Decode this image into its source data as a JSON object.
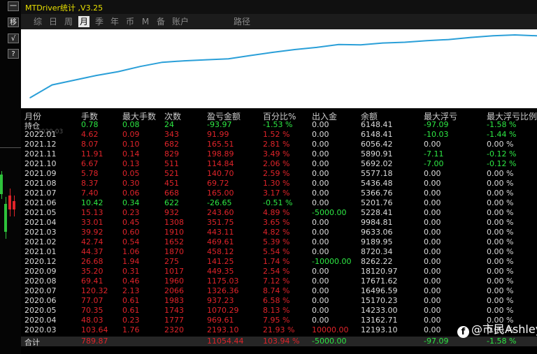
{
  "toolbar": {
    "buttons": [
      {
        "label": "一",
        "name": "minimize-button"
      },
      {
        "label": "移",
        "name": "move-button"
      },
      {
        "label": "√",
        "name": "check-button"
      },
      {
        "label": "?",
        "name": "help-button"
      }
    ]
  },
  "window": {
    "title": "MTDriver统计 ,V3.25"
  },
  "tabs": [
    {
      "label": "综",
      "active": false
    },
    {
      "label": "日",
      "active": false
    },
    {
      "label": "周",
      "active": false
    },
    {
      "label": "月",
      "active": true
    },
    {
      "label": "季",
      "active": false
    },
    {
      "label": "年",
      "active": false
    },
    {
      "label": "币",
      "active": false
    },
    {
      "label": "M",
      "active": false
    },
    {
      "label": "备",
      "active": false
    },
    {
      "label": "账户",
      "active": false
    },
    {
      "label": "路径",
      "active": false
    }
  ],
  "chart_data": {
    "type": "line",
    "x_start_label": "2020.03",
    "x": [
      "2020.03",
      "2020.04",
      "2020.05",
      "2020.06",
      "2020.07",
      "2020.08",
      "2020.09",
      "2020.10",
      "2020.11",
      "2020.12",
      "2021.01",
      "2021.02",
      "2021.03",
      "2021.04",
      "2021.05",
      "2021.06",
      "2021.07",
      "2021.08",
      "2021.09",
      "2021.10",
      "2021.11",
      "2021.12",
      "2022.01",
      "持仓"
    ],
    "values": [
      0.0,
      21.93,
      29.88,
      38.01,
      44.59,
      53.33,
      60.45,
      63.0,
      64.74,
      66.48,
      72.02,
      77.41,
      82.23,
      85.88,
      90.77,
      90.26,
      93.43,
      94.73,
      97.32,
      99.38,
      102.87,
      105.68,
      107.2,
      105.67
    ],
    "line_color": "#2a9fd8",
    "grid": false
  },
  "table": {
    "headers": [
      "月份",
      "手数",
      "最大手数",
      "次数",
      "盈亏金额",
      "百分比%",
      "出入金",
      "余额",
      "最大浮亏",
      "最大浮亏比例"
    ],
    "rows": [
      {
        "month": "持仓",
        "lots": "0.78",
        "maxlots": "0.08",
        "count": "24",
        "pnl": "-93.97",
        "pct": "-1.53 %",
        "deposit": "0.00",
        "balance": "6148.41",
        "maxdd": "-97.09",
        "ddpct": "-1.58 %",
        "tone": "green"
      },
      {
        "month": "2022.01",
        "lots": "4.62",
        "maxlots": "0.09",
        "count": "343",
        "pnl": "91.99",
        "pct": "1.52 %",
        "deposit": "0.00",
        "balance": "6148.41",
        "maxdd": "-10.03",
        "ddpct": "-1.44 %",
        "tone": "red"
      },
      {
        "month": "2021.12",
        "lots": "8.07",
        "maxlots": "0.10",
        "count": "682",
        "pnl": "165.51",
        "pct": "2.81 %",
        "deposit": "0.00",
        "balance": "6056.42",
        "maxdd": "0.00",
        "ddpct": "0.00 %",
        "tone": "red"
      },
      {
        "month": "2021.11",
        "lots": "11.91",
        "maxlots": "0.14",
        "count": "829",
        "pnl": "198.89",
        "pct": "3.49 %",
        "deposit": "0.00",
        "balance": "5890.91",
        "maxdd": "-7.11",
        "ddpct": "-0.12 %",
        "tone": "red"
      },
      {
        "month": "2021.10",
        "lots": "6.67",
        "maxlots": "0.13",
        "count": "511",
        "pnl": "114.84",
        "pct": "2.06 %",
        "deposit": "0.00",
        "balance": "5692.02",
        "maxdd": "-7.00",
        "ddpct": "-0.12 %",
        "tone": "red"
      },
      {
        "month": "2021.09",
        "lots": "5.78",
        "maxlots": "0.05",
        "count": "521",
        "pnl": "140.70",
        "pct": "2.59 %",
        "deposit": "0.00",
        "balance": "5577.18",
        "maxdd": "0.00",
        "ddpct": "0.00 %",
        "tone": "red"
      },
      {
        "month": "2021.08",
        "lots": "8.37",
        "maxlots": "0.30",
        "count": "451",
        "pnl": "69.72",
        "pct": "1.30 %",
        "deposit": "0.00",
        "balance": "5436.48",
        "maxdd": "0.00",
        "ddpct": "0.00 %",
        "tone": "red"
      },
      {
        "month": "2021.07",
        "lots": "7.40",
        "maxlots": "0.06",
        "count": "668",
        "pnl": "165.00",
        "pct": "3.17 %",
        "deposit": "0.00",
        "balance": "5366.76",
        "maxdd": "0.00",
        "ddpct": "0.00 %",
        "tone": "red"
      },
      {
        "month": "2021.06",
        "lots": "10.42",
        "maxlots": "0.34",
        "count": "622",
        "pnl": "-26.65",
        "pct": "-0.51 %",
        "deposit": "0.00",
        "balance": "5201.76",
        "maxdd": "0.00",
        "ddpct": "0.00 %",
        "tone": "green"
      },
      {
        "month": "2021.05",
        "lots": "15.13",
        "maxlots": "0.23",
        "count": "932",
        "pnl": "243.60",
        "pct": "4.89 %",
        "deposit": "-5000.00",
        "balance": "5228.41",
        "maxdd": "0.00",
        "ddpct": "0.00 %",
        "tone": "red"
      },
      {
        "month": "2021.04",
        "lots": "33.01",
        "maxlots": "0.45",
        "count": "1308",
        "pnl": "351.75",
        "pct": "3.65 %",
        "deposit": "0.00",
        "balance": "9984.81",
        "maxdd": "0.00",
        "ddpct": "0.00 %",
        "tone": "red"
      },
      {
        "month": "2021.03",
        "lots": "39.92",
        "maxlots": "0.60",
        "count": "1910",
        "pnl": "443.11",
        "pct": "4.82 %",
        "deposit": "0.00",
        "balance": "9633.06",
        "maxdd": "0.00",
        "ddpct": "0.00 %",
        "tone": "red"
      },
      {
        "month": "2021.02",
        "lots": "42.74",
        "maxlots": "0.54",
        "count": "1652",
        "pnl": "469.61",
        "pct": "5.39 %",
        "deposit": "0.00",
        "balance": "9189.95",
        "maxdd": "0.00",
        "ddpct": "0.00 %",
        "tone": "red"
      },
      {
        "month": "2021.01",
        "lots": "44.37",
        "maxlots": "1.06",
        "count": "1870",
        "pnl": "458.12",
        "pct": "5.54 %",
        "deposit": "0.00",
        "balance": "8720.34",
        "maxdd": "0.00",
        "ddpct": "0.00 %",
        "tone": "red"
      },
      {
        "month": "2020.12",
        "lots": "26.68",
        "maxlots": "1.94",
        "count": "275",
        "pnl": "141.25",
        "pct": "1.74 %",
        "deposit": "-10000.00",
        "balance": "8262.22",
        "maxdd": "0.00",
        "ddpct": "0.00 %",
        "tone": "red"
      },
      {
        "month": "2020.09",
        "lots": "35.20",
        "maxlots": "0.31",
        "count": "1017",
        "pnl": "449.35",
        "pct": "2.54 %",
        "deposit": "0.00",
        "balance": "18120.97",
        "maxdd": "0.00",
        "ddpct": "0.00 %",
        "tone": "red"
      },
      {
        "month": "2020.08",
        "lots": "69.41",
        "maxlots": "0.46",
        "count": "1960",
        "pnl": "1175.03",
        "pct": "7.12 %",
        "deposit": "0.00",
        "balance": "17671.62",
        "maxdd": "0.00",
        "ddpct": "0.00 %",
        "tone": "red"
      },
      {
        "month": "2020.07",
        "lots": "120.32",
        "maxlots": "2.13",
        "count": "2066",
        "pnl": "1326.36",
        "pct": "8.74 %",
        "deposit": "0.00",
        "balance": "16496.59",
        "maxdd": "0.00",
        "ddpct": "0.00 %",
        "tone": "red"
      },
      {
        "month": "2020.06",
        "lots": "77.07",
        "maxlots": "0.61",
        "count": "1983",
        "pnl": "937.23",
        "pct": "6.58 %",
        "deposit": "0.00",
        "balance": "15170.23",
        "maxdd": "0.00",
        "ddpct": "0.00 %",
        "tone": "red"
      },
      {
        "month": "2020.05",
        "lots": "70.35",
        "maxlots": "0.61",
        "count": "1743",
        "pnl": "1070.29",
        "pct": "8.13 %",
        "deposit": "0.00",
        "balance": "14233.00",
        "maxdd": "0.00",
        "ddpct": "0.00 %",
        "tone": "red"
      },
      {
        "month": "2020.04",
        "lots": "48.03",
        "maxlots": "0.23",
        "count": "1777",
        "pnl": "969.61",
        "pct": "7.95 %",
        "deposit": "0.00",
        "balance": "13162.71",
        "maxdd": "0.00",
        "ddpct": "0.00 %",
        "tone": "red"
      },
      {
        "month": "2020.03",
        "lots": "103.64",
        "maxlots": "1.76",
        "count": "2320",
        "pnl": "2193.10",
        "pct": "21.93 %",
        "deposit": "10000.00",
        "balance": "12193.10",
        "maxdd": "0.00",
        "ddpct": "0.00 %",
        "tone": "red"
      }
    ],
    "total": {
      "month": "合计",
      "lots": "789.87",
      "maxlots": "",
      "count": "",
      "pnl": "11054.44",
      "pct": "103.94 %",
      "deposit": "-5000.00",
      "balance": "",
      "maxdd": "-97.09",
      "ddpct": "-1.58 %"
    }
  },
  "watermark": {
    "icon": "facebook-icon",
    "text": "@市民Ashley"
  },
  "colors": {
    "profit": "#e0242a",
    "loss": "#2ee844",
    "title": "#e8e000",
    "line": "#2a9fd8"
  }
}
